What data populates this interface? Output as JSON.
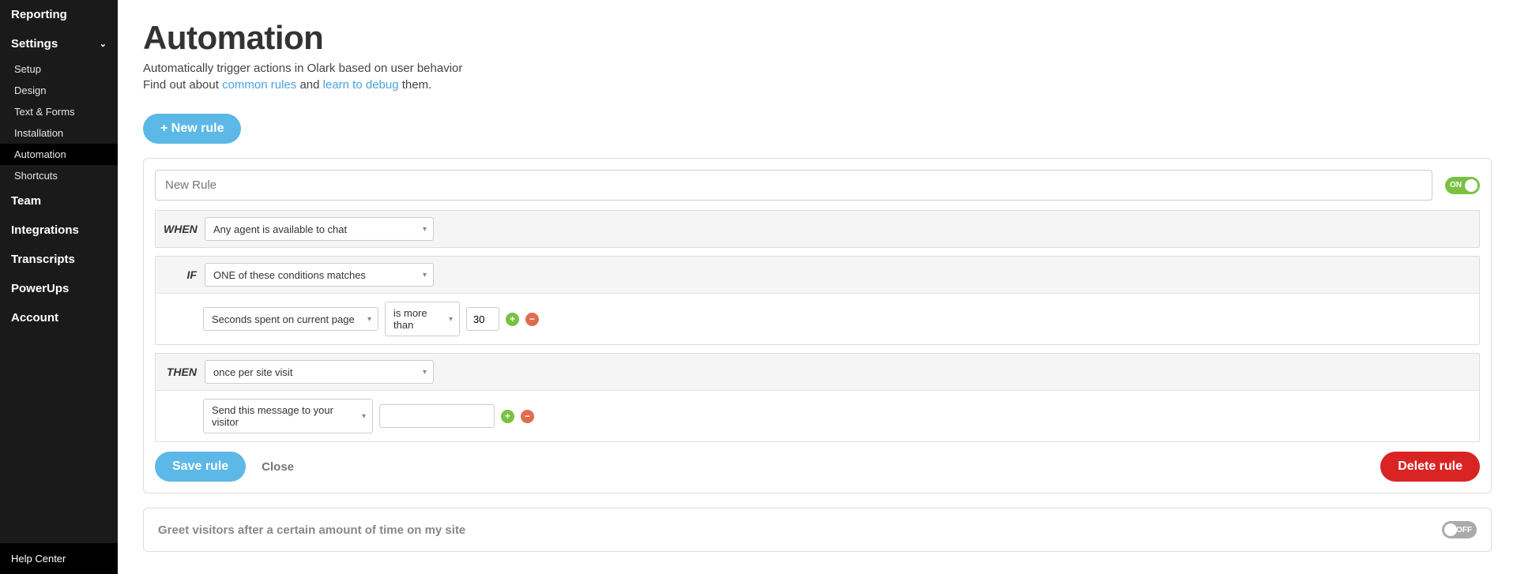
{
  "sidebar": {
    "items": [
      {
        "label": "Reporting",
        "type": "top"
      },
      {
        "label": "Settings",
        "type": "top",
        "expanded": true
      },
      {
        "label": "Setup",
        "type": "sub"
      },
      {
        "label": "Design",
        "type": "sub"
      },
      {
        "label": "Text & Forms",
        "type": "sub"
      },
      {
        "label": "Installation",
        "type": "sub"
      },
      {
        "label": "Automation",
        "type": "sub",
        "active": true
      },
      {
        "label": "Shortcuts",
        "type": "sub"
      },
      {
        "label": "Team",
        "type": "top"
      },
      {
        "label": "Integrations",
        "type": "top"
      },
      {
        "label": "Transcripts",
        "type": "top"
      },
      {
        "label": "PowerUps",
        "type": "top"
      },
      {
        "label": "Account",
        "type": "top"
      }
    ],
    "footer": "Help Center"
  },
  "page": {
    "title": "Automation",
    "subtitle_line1": "Automatically trigger actions in Olark based on user behavior",
    "subtitle_prefix": "Find out about ",
    "subtitle_link1": "common rules",
    "subtitle_mid": " and ",
    "subtitle_link2": "learn to debug",
    "subtitle_suffix": " them.",
    "new_rule_button": "+ New rule"
  },
  "rule": {
    "name_placeholder": "New Rule",
    "toggle_on_label": "ON",
    "when": {
      "label": "WHEN",
      "value": "Any agent is available to chat"
    },
    "if": {
      "label": "IF",
      "match_mode": "ONE of these conditions matches",
      "condition": {
        "field": "Seconds spent on current page",
        "operator": "is more than",
        "value": "30"
      }
    },
    "then": {
      "label": "THEN",
      "frequency": "once per site visit",
      "action": {
        "type": "Send this message to your visitor",
        "value": ""
      }
    },
    "save_label": "Save rule",
    "close_label": "Close",
    "delete_label": "Delete rule"
  },
  "collapsed_rule": {
    "title": "Greet visitors after a certain amount of time on my site",
    "toggle_off_label": "OFF"
  }
}
